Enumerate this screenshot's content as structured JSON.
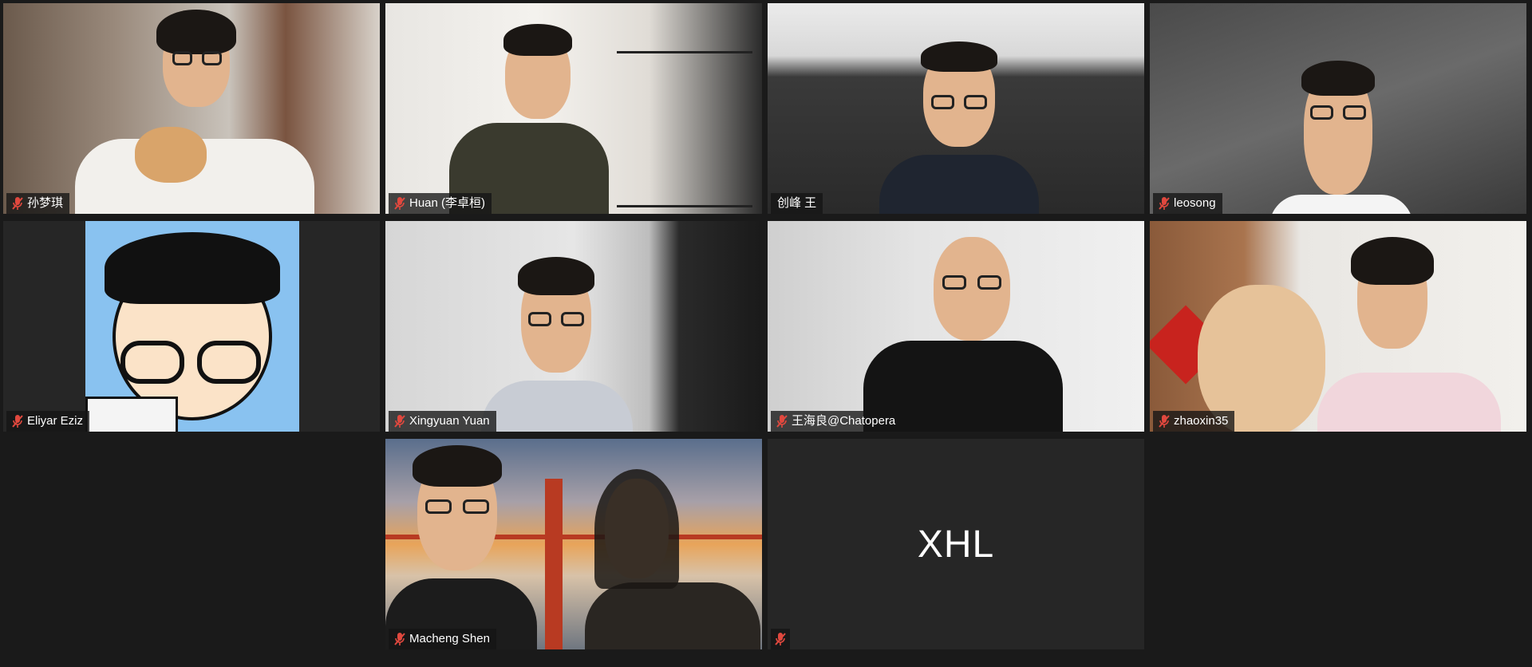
{
  "window": {
    "background": "#1a1a1a",
    "active_speaker_color": "#c9e26a",
    "mute_icon_color": "#e0483e"
  },
  "participants": [
    {
      "name": "孙梦琪",
      "muted": true,
      "video": true
    },
    {
      "name": "Huan (李卓桓)",
      "muted": true,
      "video": true
    },
    {
      "name": "创峰 王",
      "muted": false,
      "video": true,
      "active_speaker": true
    },
    {
      "name": "leosong",
      "muted": true,
      "video": true
    },
    {
      "name": "Eliyar Eziz",
      "muted": true,
      "video": true
    },
    {
      "name": "Xingyuan Yuan",
      "muted": true,
      "video": true
    },
    {
      "name": "王海良@Chatopera",
      "muted": true,
      "video": true
    },
    {
      "name": "zhaoxin35",
      "muted": true,
      "video": true
    },
    {
      "name": "Macheng Shen",
      "muted": true,
      "video": true
    },
    {
      "name": "",
      "initials": "XHL",
      "muted": true,
      "video": false
    }
  ]
}
